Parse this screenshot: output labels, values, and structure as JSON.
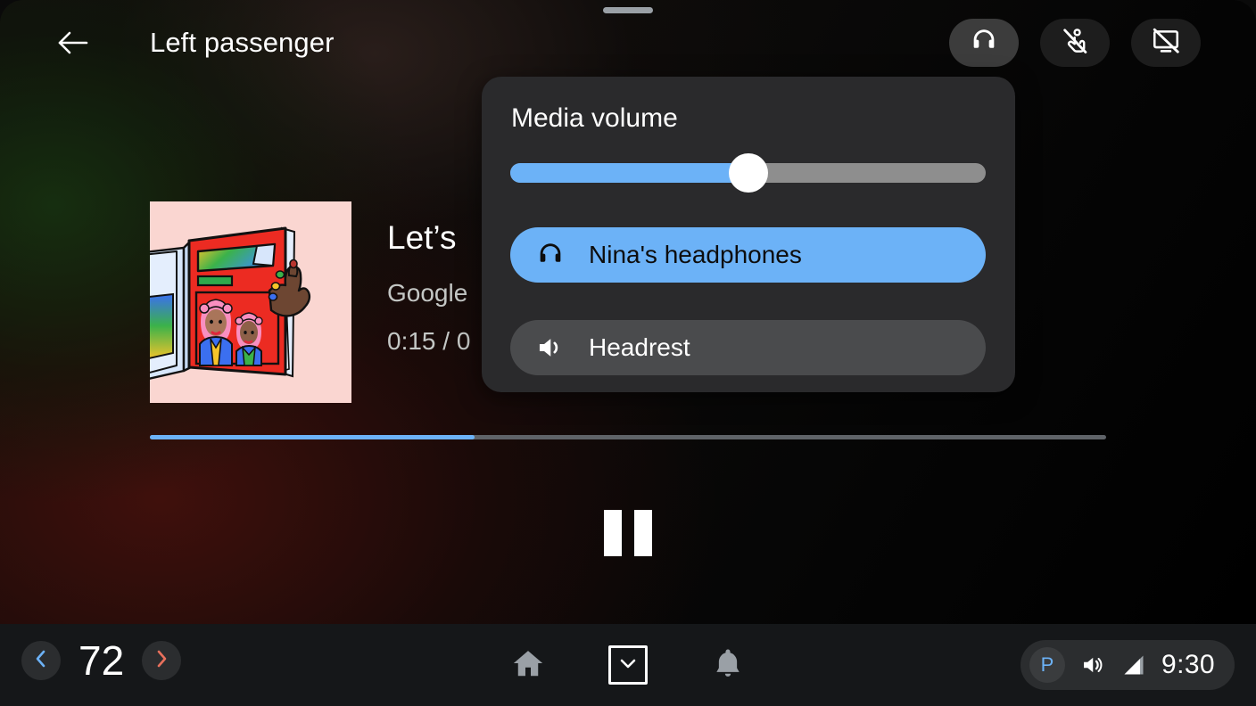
{
  "window": {
    "drag_handle": "drag-handle"
  },
  "appbar": {
    "back_icon": "arrow-left-icon",
    "title": "Left passenger",
    "actions": [
      {
        "icon": "headphones-icon",
        "name": "headphones-toggle",
        "active": true
      },
      {
        "icon": "touch-off-icon",
        "name": "touch-disable-toggle",
        "active": false
      },
      {
        "icon": "screen-off-icon",
        "name": "screen-off-toggle",
        "active": false
      }
    ]
  },
  "media": {
    "album_art_alt": "magazine-cover-illustration",
    "title": "Let’s",
    "artist": "Google",
    "time": "0:15 / 0",
    "progress_percent": 34,
    "transport": {
      "state": "playing",
      "button": "pause-button"
    }
  },
  "volume_panel": {
    "title": "Media volume",
    "slider": {
      "value_percent": 50
    },
    "devices": [
      {
        "label": "Nina's headphones",
        "icon": "headphones-icon",
        "selected": true
      },
      {
        "label": "Headrest",
        "icon": "speaker-icon",
        "selected": false
      }
    ]
  },
  "system_bar": {
    "temperature": {
      "decrease_icon": "chevron-left-icon",
      "value": "72",
      "increase_icon": "chevron-right-icon"
    },
    "nav": [
      {
        "name": "home-button",
        "icon": "home-icon"
      },
      {
        "name": "app-switcher-button",
        "icon": "chevron-down-icon"
      },
      {
        "name": "notifications-button",
        "icon": "bell-icon"
      }
    ],
    "status": {
      "gear_indicator": "P",
      "volume_icon": "speaker-icon",
      "signal_icon": "signal-bars-icon",
      "clock": "9:30"
    }
  },
  "colors": {
    "accent_blue": "#6cb2f7",
    "panel_bg": "#2a2a2c",
    "unselected_row": "#4a4b4d",
    "sysbar_bg": "#151719",
    "album_bg": "#fad6d1",
    "temp_down": "#6cb2f7",
    "temp_up": "#e8705c"
  }
}
